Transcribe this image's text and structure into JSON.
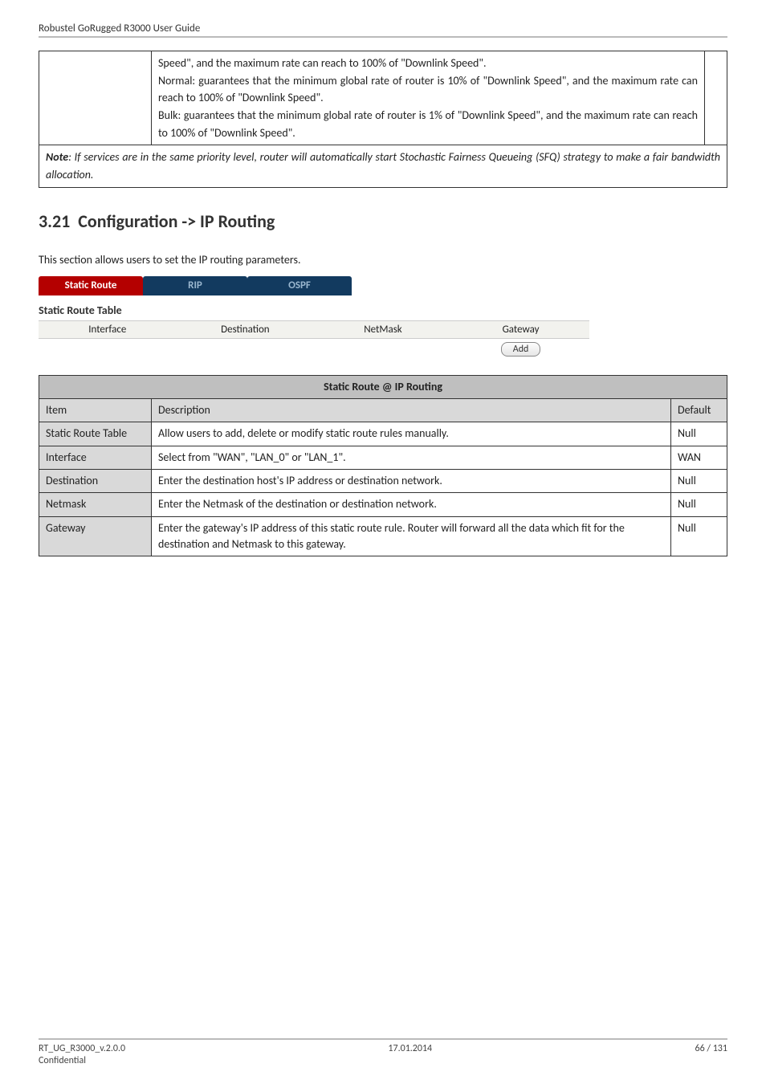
{
  "runhead": "Robustel GoRugged R3000 User Guide",
  "cont_table": {
    "body_lines": [
      "Speed\", and the maximum rate can reach to 100% of \"Downlink Speed\".",
      "Normal: guarantees that the minimum global rate of router is 10% of \"Downlink Speed\", and the maximum rate can reach to 100% of \"Downlink Speed\".",
      "Bulk: guarantees that the minimum global rate of router is 1% of \"Downlink Speed\", and the maximum rate can reach to 100% of \"Downlink Speed\"."
    ],
    "note_prefix": "Note",
    "note_body": ": If services are in the same priority level, router will automatically start Stochastic Fairness Queueing (SFQ) strategy to make a fair bandwidth allocation."
  },
  "section_number": "3.21",
  "section_title": "Configuration -> IP Routing",
  "intro_para": "This section allows users to set the IP routing parameters.",
  "tabs": {
    "active": "Static Route",
    "t2": "RIP",
    "t3": "OSPF"
  },
  "srt": {
    "title": "Static Route Table",
    "h1": "Interface",
    "h2": "Destination",
    "h3": "NetMask",
    "h4": "Gateway",
    "add": "Add"
  },
  "spec": {
    "banner": "Static Route @ IP Routing",
    "h_item": "Item",
    "h_desc": "Description",
    "h_def": "Default",
    "rows": [
      {
        "c1": "Static Route Table",
        "c2": "Allow users to add, delete or modify static route rules manually.",
        "c3": "Null"
      },
      {
        "c1": "Interface",
        "c2": "Select from \"WAN\", \"LAN_0\" or \"LAN_1\".",
        "c3": "WAN"
      },
      {
        "c1": "Destination",
        "c2": "Enter the destination host's IP address or destination network.",
        "c3": "Null"
      },
      {
        "c1": "Netmask",
        "c2": "Enter the Netmask of the destination or destination network.",
        "c3": "Null"
      },
      {
        "c1": "Gateway",
        "c2": "Enter the gateway's IP address of this static route rule. Router will forward all the data which fit for the destination and Netmask to this gateway.",
        "c3": "Null"
      }
    ]
  },
  "footer": {
    "doc": "RT_UG_R3000_v.2.0.0",
    "conf": "Confidential",
    "date": "17.01.2014",
    "page": "66 / 131"
  }
}
